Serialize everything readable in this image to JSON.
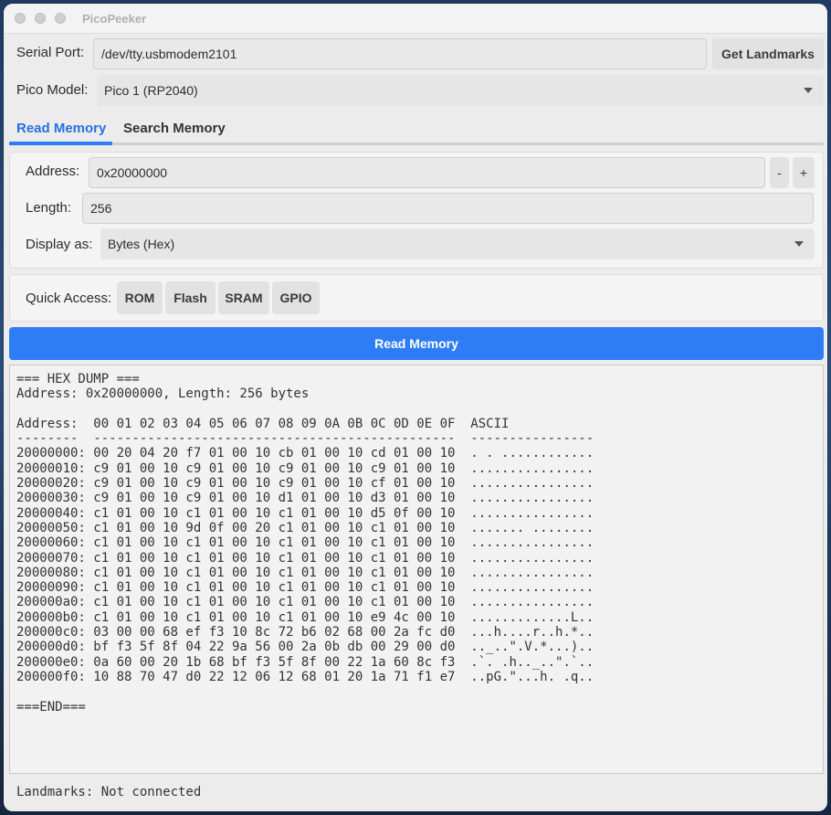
{
  "window": {
    "title": "PicoPeeker"
  },
  "serial": {
    "label": "Serial Port:",
    "value": "/dev/tty.usbmodem2101",
    "button": "Get Landmarks"
  },
  "model": {
    "label": "Pico Model:",
    "value": "Pico 1 (RP2040)"
  },
  "tabs": [
    {
      "label": "Read Memory",
      "active": true
    },
    {
      "label": "Search Memory",
      "active": false
    }
  ],
  "read": {
    "address_label": "Address:",
    "address_value": "0x20000000",
    "minus_label": "-",
    "plus_label": "+",
    "length_label": "Length:",
    "length_value": "256",
    "display_label": "Display as:",
    "display_value": "Bytes (Hex)"
  },
  "quick": {
    "label": "Quick Access:",
    "buttons": [
      "ROM",
      "Flash",
      "SRAM",
      "GPIO"
    ]
  },
  "read_button": "Read Memory",
  "output": "=== HEX DUMP ===\nAddress: 0x20000000, Length: 256 bytes\n\nAddress:  00 01 02 03 04 05 06 07 08 09 0A 0B 0C 0D 0E 0F  ASCII\n--------  -----------------------------------------------  ----------------\n20000000: 00 20 04 20 f7 01 00 10 cb 01 00 10 cd 01 00 10  . . ............\n20000010: c9 01 00 10 c9 01 00 10 c9 01 00 10 c9 01 00 10  ................\n20000020: c9 01 00 10 c9 01 00 10 c9 01 00 10 cf 01 00 10  ................\n20000030: c9 01 00 10 c9 01 00 10 d1 01 00 10 d3 01 00 10  ................\n20000040: c1 01 00 10 c1 01 00 10 c1 01 00 10 d5 0f 00 10  ................\n20000050: c1 01 00 10 9d 0f 00 20 c1 01 00 10 c1 01 00 10  ....... ........\n20000060: c1 01 00 10 c1 01 00 10 c1 01 00 10 c1 01 00 10  ................\n20000070: c1 01 00 10 c1 01 00 10 c1 01 00 10 c1 01 00 10  ................\n20000080: c1 01 00 10 c1 01 00 10 c1 01 00 10 c1 01 00 10  ................\n20000090: c1 01 00 10 c1 01 00 10 c1 01 00 10 c1 01 00 10  ................\n200000a0: c1 01 00 10 c1 01 00 10 c1 01 00 10 c1 01 00 10  ................\n200000b0: c1 01 00 10 c1 01 00 10 c1 01 00 10 e9 4c 00 10  .............L..\n200000c0: 03 00 00 68 ef f3 10 8c 72 b6 02 68 00 2a fc d0  ...h....r..h.*..\n200000d0: bf f3 5f 8f 04 22 9a 56 00 2a 0b db 00 29 00 d0  .._..\".V.*...)..\n200000e0: 0a 60 00 20 1b 68 bf f3 5f 8f 00 22 1a 60 8c f3  .`. .h.._..\".`..\n200000f0: 10 88 70 47 d0 22 12 06 12 68 01 20 1a 71 f1 e7  ..pG.\"...h. .q..\n\n===END===",
  "status": "Landmarks: Not connected",
  "colors": {
    "accent": "#2f7df6",
    "tab_active": "#2a6fe0"
  }
}
